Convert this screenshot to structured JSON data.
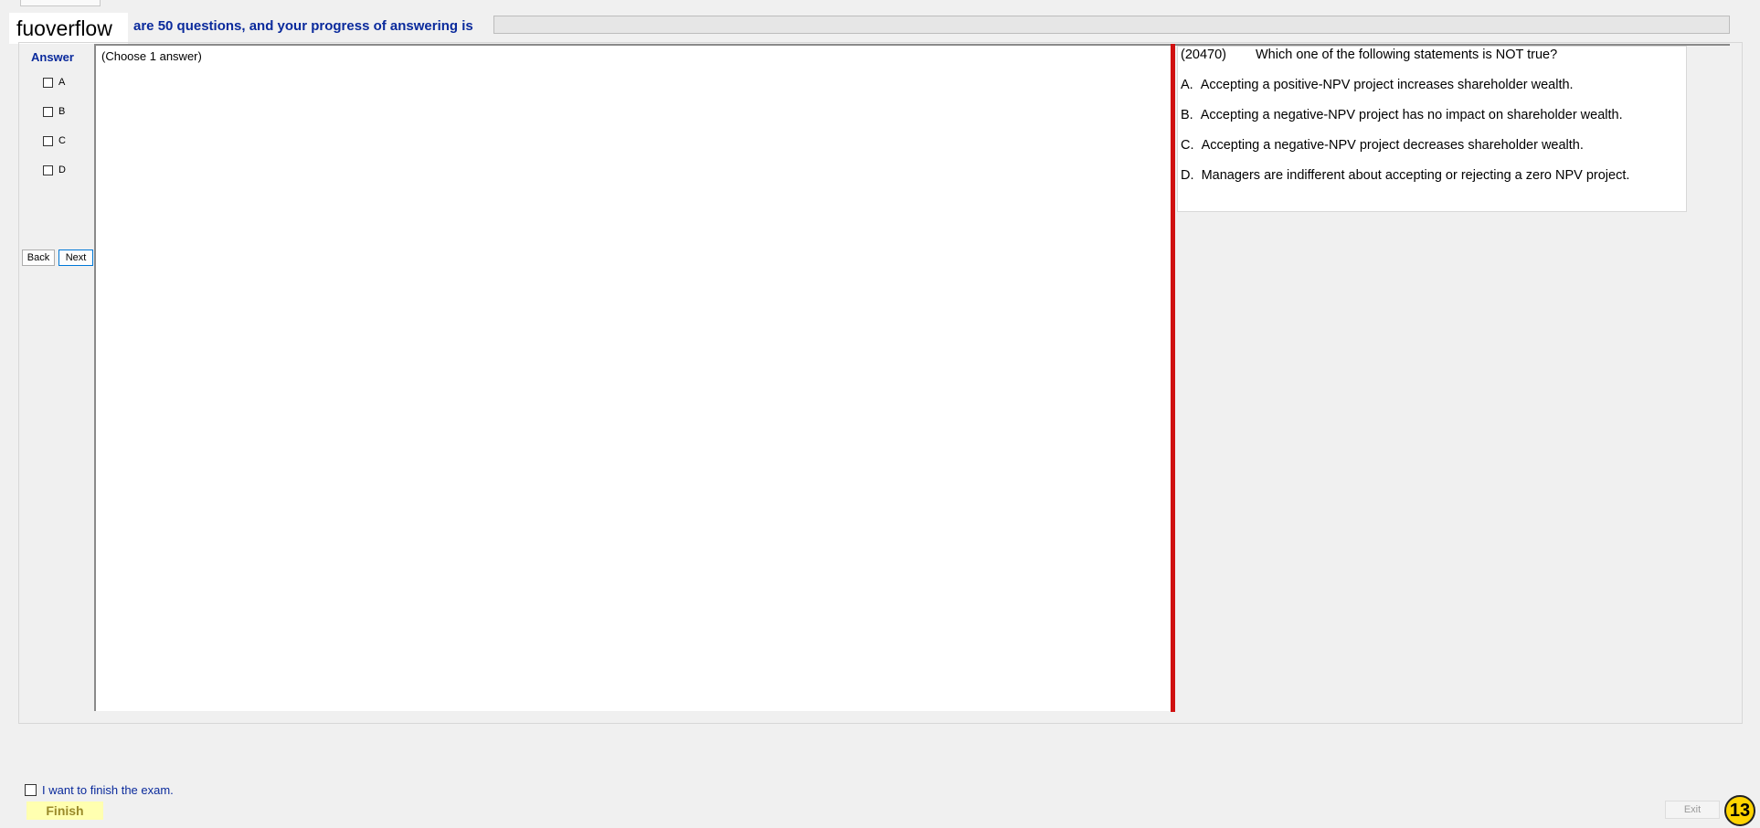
{
  "brand": "fuoverflow",
  "header": {
    "text": "are 50 questions, and your progress of answering is",
    "progress": 0
  },
  "answer_panel": {
    "title": "Answer",
    "options": [
      "A",
      "B",
      "C",
      "D"
    ],
    "back_label": "Back",
    "next_label": "Next"
  },
  "center": {
    "instruction": "(Choose 1 answer)"
  },
  "question": {
    "number": "(20470)",
    "text": "Which one of the following statements is NOT true?",
    "options": [
      {
        "letter": "A.",
        "text": "Accepting a positive-NPV project increases shareholder wealth."
      },
      {
        "letter": "B.",
        "text": "Accepting a negative-NPV project has no impact on shareholder wealth."
      },
      {
        "letter": "C.",
        "text": "Accepting a negative-NPV project decreases shareholder wealth."
      },
      {
        "letter": "D.",
        "text": "Managers are indifferent about accepting or rejecting a zero NPV project."
      }
    ]
  },
  "footer": {
    "finish_check_label": "I want to finish the exam.",
    "finish_label": "Finish",
    "exit_label": "Exit",
    "badge": "13"
  },
  "colors": {
    "header_text": "#0a2a9c",
    "divider": "#d01010",
    "finish_bg": "#ffffb0",
    "badge_bg": "#ffd400"
  }
}
